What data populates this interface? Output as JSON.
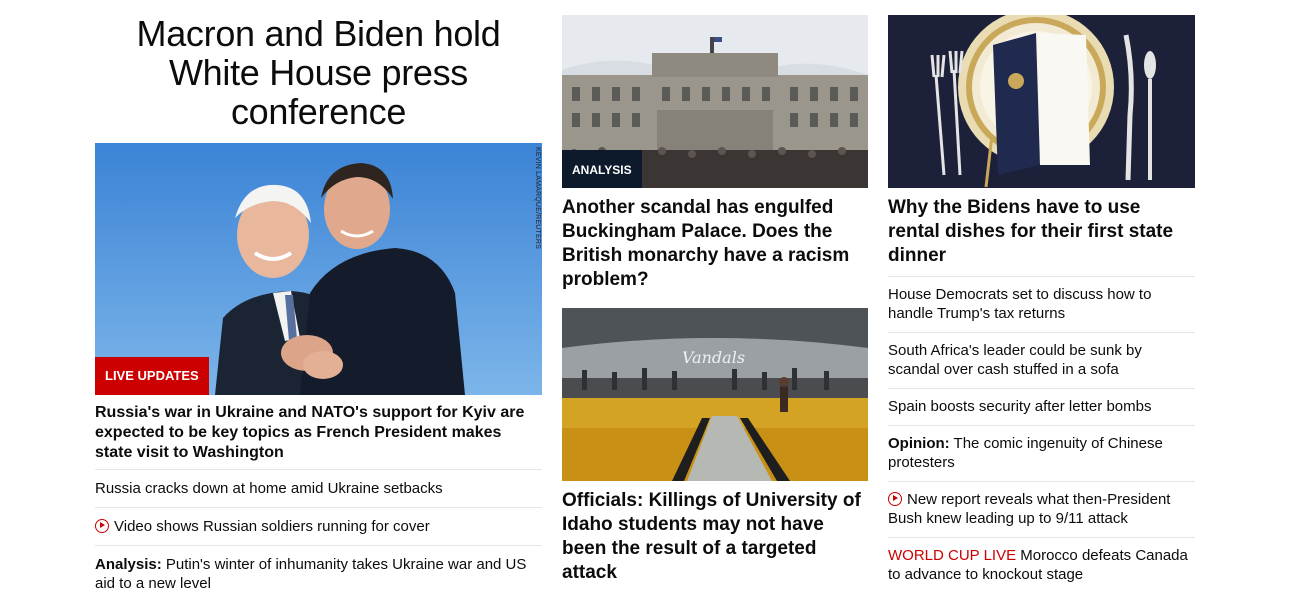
{
  "hero": {
    "title": "Macron and Biden hold White House press conference",
    "image_credit": "KEVIN LAMARQUE/REUTERS",
    "badge": "LIVE UPDATES",
    "lead": "Russia's war in Ukraine and NATO's support for Kyiv are expected to be key topics as French President makes state visit to Washington",
    "links": [
      {
        "prefix": "",
        "text": "Russia cracks down at home amid Ukraine setbacks",
        "icon": ""
      },
      {
        "prefix": "",
        "text": "Video shows Russian soldiers running for cover",
        "icon": "play-icon"
      },
      {
        "prefix": "Analysis:",
        "text": " Putin's winter of inhumanity takes Ukraine war and US aid to a new level",
        "icon": ""
      }
    ]
  },
  "middle": {
    "story1": {
      "badge": "ANALYSIS",
      "title": "Another scandal has engulfed Buckingham Palace. Does the British monarchy have a racism problem?"
    },
    "story2": {
      "sign_text": "Vandals",
      "title": "Officials: Killings of University of Idaho students may not have been the result of a targeted attack"
    }
  },
  "right": {
    "story": {
      "title": "Why the Bidens have to use rental dishes for their first state dinner"
    },
    "links": [
      {
        "prefix": "",
        "text": "House Democrats set to discuss how to handle Trump's tax returns"
      },
      {
        "prefix": "",
        "text": "South Africa's leader could be sunk by scandal over cash stuffed in a sofa"
      },
      {
        "prefix": "",
        "text": "Spain boosts security after letter bombs"
      },
      {
        "prefix": "Opinion:",
        "text": " The comic ingenuity of Chinese protesters"
      },
      {
        "prefix": "",
        "text": "New report reveals what then-President Bush knew leading up to 9/11 attack",
        "icon": "play-icon"
      },
      {
        "prefix": "WORLD CUP LIVE",
        "text": " Morocco defeats Canada to advance to knockout stage"
      }
    ]
  },
  "colors": {
    "brand_red": "#cc0000",
    "analysis_badge": "#0c1a2b",
    "divider": "#e6e6e6"
  }
}
